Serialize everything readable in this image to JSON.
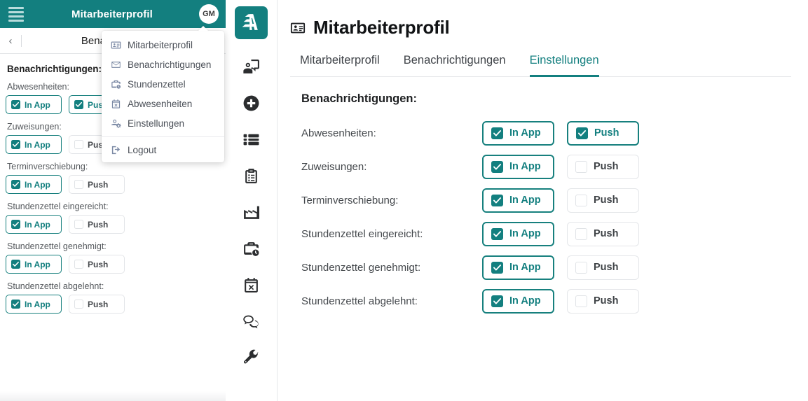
{
  "theme": {
    "accent": "#137f7f",
    "accent_border": "#17807e",
    "header_bg": "#137f7f",
    "text_dark": "#1d1f21",
    "muted": "#6b6f73"
  },
  "mobile_preview": {
    "header": {
      "title": "Mitarbeiterprofil",
      "avatar_initials": "GM",
      "menu_icon": "hamburger-icon"
    },
    "subbar": {
      "back_icon": "chevron-left-icon",
      "title": "Benachrichtigu"
    },
    "section_title": "Benachrichtigungen:",
    "rows": [
      {
        "label": "Abwesenheiten:",
        "in_app": {
          "label": "In App",
          "checked": true
        },
        "push": {
          "label": "Push",
          "checked": true
        }
      },
      {
        "label": "Zuweisungen:",
        "in_app": {
          "label": "In App",
          "checked": true
        },
        "push": {
          "label": "Push",
          "checked": false
        }
      },
      {
        "label": "Terminverschiebung:",
        "in_app": {
          "label": "In App",
          "checked": true
        },
        "push": {
          "label": "Push",
          "checked": false
        }
      },
      {
        "label": "Stundenzettel eingereicht:",
        "in_app": {
          "label": "In App",
          "checked": true
        },
        "push": {
          "label": "Push",
          "checked": false
        }
      },
      {
        "label": "Stundenzettel genehmigt:",
        "in_app": {
          "label": "In App",
          "checked": true
        },
        "push": {
          "label": "Push",
          "checked": false
        }
      },
      {
        "label": "Stundenzettel abgelehnt:",
        "in_app": {
          "label": "In App",
          "checked": true
        },
        "push": {
          "label": "Push",
          "checked": false
        }
      }
    ]
  },
  "dropdown_menu": {
    "items": [
      {
        "label": "Mitarbeiterprofil",
        "icon": "id-card-icon"
      },
      {
        "label": "Benachrichtigungen",
        "icon": "envelope-icon"
      },
      {
        "label": "Stundenzettel",
        "icon": "briefcase-clock-icon"
      },
      {
        "label": "Abwesenheiten",
        "icon": "calendar-x-icon"
      },
      {
        "label": "Einstellungen",
        "icon": "user-gear-icon"
      }
    ],
    "logout": {
      "label": "Logout",
      "icon": "sign-out-icon"
    }
  },
  "icon_rail": {
    "logo": {
      "name": "app-logo",
      "alt": "A"
    },
    "items": [
      {
        "icon": "user-presentation-icon"
      },
      {
        "icon": "plus-circle-icon"
      },
      {
        "icon": "list-grid-icon"
      },
      {
        "icon": "clipboard-list-icon"
      },
      {
        "icon": "factory-icon"
      },
      {
        "icon": "briefcase-clock-icon"
      },
      {
        "icon": "calendar-x-icon"
      },
      {
        "icon": "chat-bubbles-icon"
      },
      {
        "icon": "wrench-icon"
      }
    ]
  },
  "main": {
    "title": "Mitarbeiterprofil",
    "title_icon": "id-card-icon",
    "tabs": [
      {
        "label": "Mitarbeiterprofil",
        "active": false
      },
      {
        "label": "Benachrichtigungen",
        "active": false
      },
      {
        "label": "Einstellungen",
        "active": true
      }
    ],
    "settings_heading": "Benachrichtigungen:",
    "rows": [
      {
        "label": "Abwesenheiten:",
        "in_app": {
          "label": "In App",
          "checked": true
        },
        "push": {
          "label": "Push",
          "checked": true
        }
      },
      {
        "label": "Zuweisungen:",
        "in_app": {
          "label": "In App",
          "checked": true
        },
        "push": {
          "label": "Push",
          "checked": false
        }
      },
      {
        "label": "Terminverschiebung:",
        "in_app": {
          "label": "In App",
          "checked": true
        },
        "push": {
          "label": "Push",
          "checked": false
        }
      },
      {
        "label": "Stundenzettel eingereicht:",
        "in_app": {
          "label": "In App",
          "checked": true
        },
        "push": {
          "label": "Push",
          "checked": false
        }
      },
      {
        "label": "Stundenzettel genehmigt:",
        "in_app": {
          "label": "In App",
          "checked": true
        },
        "push": {
          "label": "Push",
          "checked": false
        }
      },
      {
        "label": "Stundenzettel abgelehnt:",
        "in_app": {
          "label": "In App",
          "checked": true
        },
        "push": {
          "label": "Push",
          "checked": false
        }
      }
    ]
  }
}
